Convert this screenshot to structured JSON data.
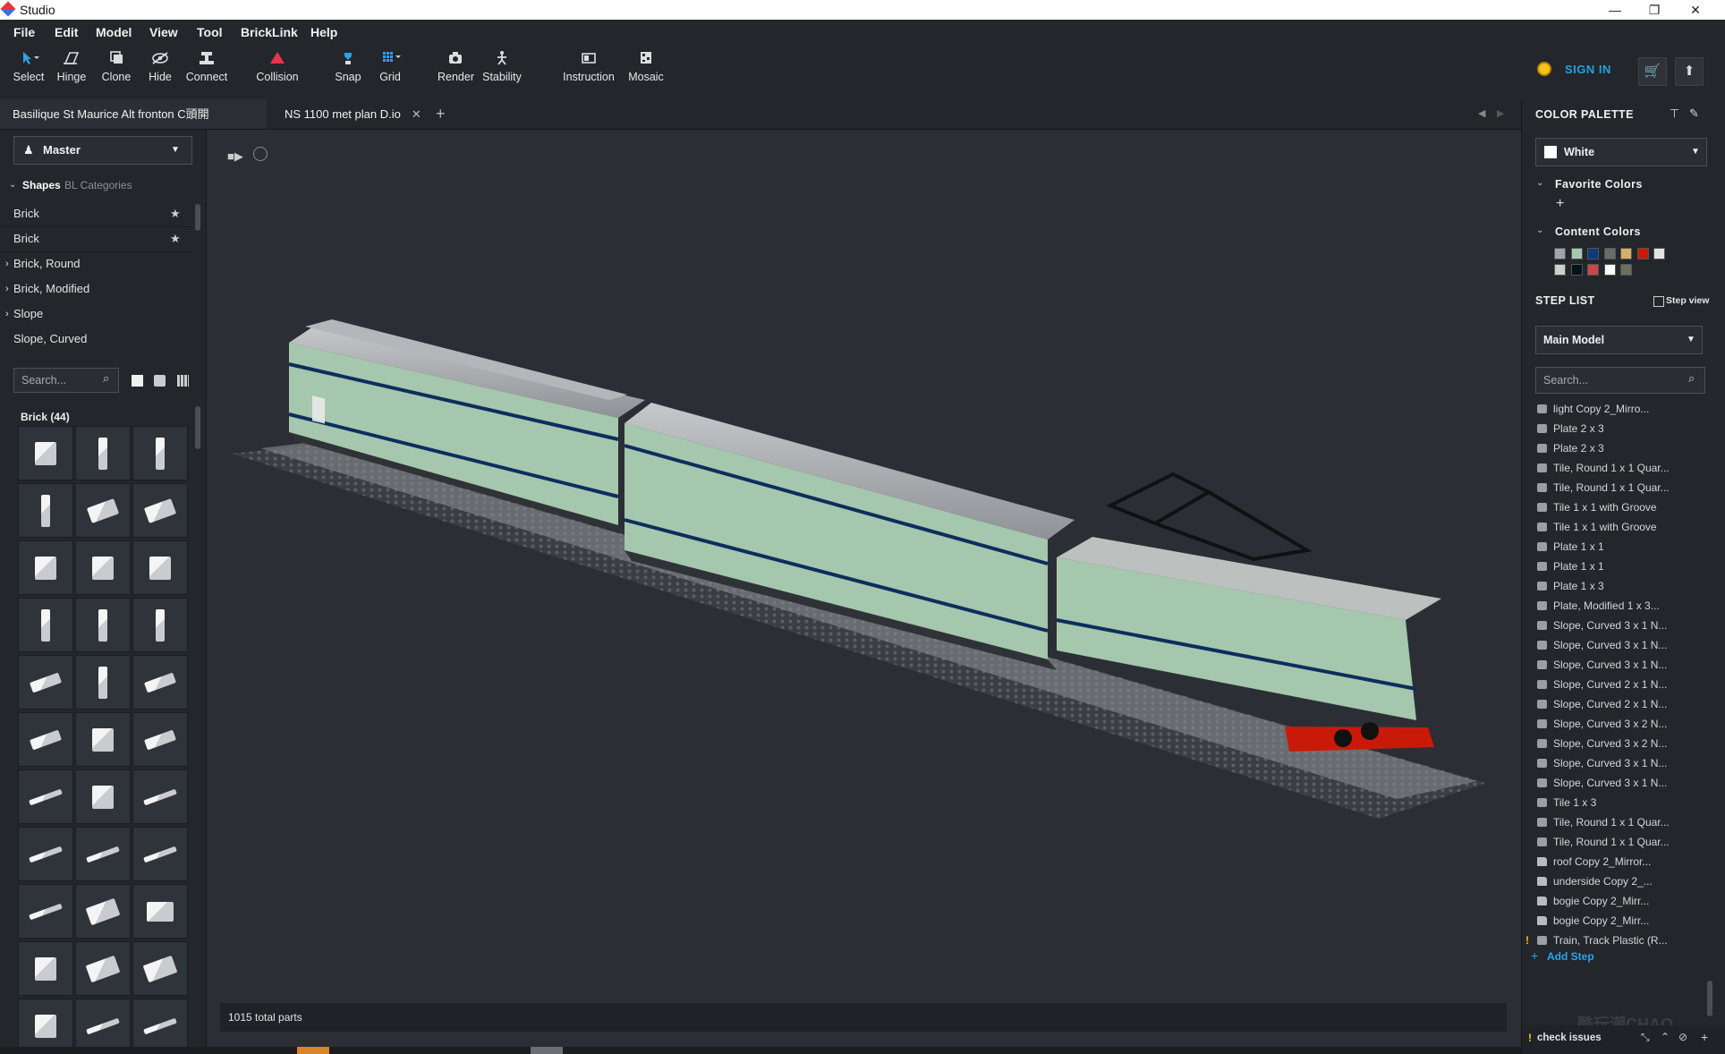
{
  "window": {
    "title": "Studio",
    "controls": [
      "—",
      "❐",
      "✕"
    ]
  },
  "menu": [
    "File",
    "Edit",
    "Model",
    "View",
    "Tool",
    "BrickLink",
    "Help"
  ],
  "toolbar": {
    "tools": [
      {
        "id": "select",
        "label": "Select"
      },
      {
        "id": "hinge",
        "label": "Hinge"
      },
      {
        "id": "clone",
        "label": "Clone"
      },
      {
        "id": "hide",
        "label": "Hide"
      },
      {
        "id": "connect",
        "label": "Connect"
      },
      {
        "id": "collision",
        "label": "Collision"
      },
      {
        "id": "snap",
        "label": "Snap"
      },
      {
        "id": "grid",
        "label": "Grid"
      },
      {
        "id": "render",
        "label": "Render"
      },
      {
        "id": "stability",
        "label": "Stability"
      },
      {
        "id": "instruction",
        "label": "Instruction"
      },
      {
        "id": "mosaic",
        "label": "Mosaic"
      }
    ],
    "sign_in": "SIGN IN"
  },
  "tabs": [
    {
      "label": "Basilique St Maurice Alt fronton C頭開Copy.io",
      "active": true
    },
    {
      "label": "NS 1100 met plan D.io",
      "active": false
    }
  ],
  "left": {
    "palette_select": "Master",
    "shape_tabs": {
      "shapes": "Shapes",
      "bl": "BL Categories"
    },
    "categories": [
      {
        "label": "Brick",
        "star": true
      },
      {
        "label": "Brick",
        "star": true
      },
      {
        "label": "Brick, Round",
        "expand": true
      },
      {
        "label": "Brick, Modified",
        "expand": true
      },
      {
        "label": "Slope",
        "expand": true
      },
      {
        "label": "Slope, Curved",
        "expand": false
      }
    ],
    "search_placeholder": "Search...",
    "brick_header": "Brick (44)"
  },
  "viewport": {
    "status": "1015 total parts"
  },
  "right": {
    "color_palette_title": "COLOR PALETTE",
    "selected_color": "White",
    "favorite_colors_title": "Favorite Colors",
    "content_colors_title": "Content Colors",
    "content_colors": [
      "#a0a5a9",
      "#a5c9b0",
      "#0d3a7a",
      "#6b6b6b",
      "#d4b068",
      "#c91a09",
      "#e4e4e4",
      "#cfd0cc",
      "#05131d",
      "#c9474a",
      "#ffffff",
      "#6d6e5c"
    ],
    "step_list_title": "STEP LIST",
    "step_view": "Step view",
    "model_select": "Main Model",
    "search_placeholder": "Search...",
    "steps": [
      {
        "label": "light Copy 2_Mirro...",
        "icon": "brick"
      },
      {
        "label": "Plate 2 x 3",
        "icon": "brick"
      },
      {
        "label": "Plate 2 x 3",
        "icon": "brick"
      },
      {
        "label": "Tile, Round 1 x 1 Quar...",
        "icon": "brick"
      },
      {
        "label": "Tile, Round 1 x 1 Quar...",
        "icon": "brick"
      },
      {
        "label": "Tile 1 x 1 with Groove",
        "icon": "brick"
      },
      {
        "label": "Tile 1 x 1 with Groove",
        "icon": "brick"
      },
      {
        "label": "Plate 1 x 1",
        "icon": "brick"
      },
      {
        "label": "Plate 1 x 1",
        "icon": "brick"
      },
      {
        "label": "Plate 1 x 3",
        "icon": "brick"
      },
      {
        "label": "Plate, Modified 1 x 3...",
        "icon": "brick"
      },
      {
        "label": "Slope, Curved 3 x 1 N...",
        "icon": "brick"
      },
      {
        "label": "Slope, Curved 3 x 1 N...",
        "icon": "brick"
      },
      {
        "label": "Slope, Curved 3 x 1 N...",
        "icon": "brick"
      },
      {
        "label": "Slope, Curved 2 x 1 N...",
        "icon": "brick"
      },
      {
        "label": "Slope, Curved 2 x 1 N...",
        "icon": "brick"
      },
      {
        "label": "Slope, Curved 3 x 2 N...",
        "icon": "brick"
      },
      {
        "label": "Slope, Curved 3 x 2 N...",
        "icon": "brick"
      },
      {
        "label": "Slope, Curved 3 x 1 N...",
        "icon": "brick"
      },
      {
        "label": "Slope, Curved 3 x 1 N...",
        "icon": "brick"
      },
      {
        "label": "Tile 1 x 3",
        "icon": "brick"
      },
      {
        "label": "Tile, Round 1 x 1 Quar...",
        "icon": "brick"
      },
      {
        "label": "Tile, Round 1 x 1 Quar...",
        "icon": "brick"
      },
      {
        "label": "roof Copy 2_Mirror...",
        "icon": "folder"
      },
      {
        "label": "underside Copy 2_...",
        "icon": "folder"
      },
      {
        "label": "bogie Copy 2_Mirr...",
        "icon": "folder"
      },
      {
        "label": "bogie Copy 2_Mirr...",
        "icon": "folder"
      },
      {
        "label": "Train, Track Plastic (R...",
        "icon": "brick",
        "warn": true
      }
    ],
    "add_step": "Add Step",
    "check_issues": "check issues",
    "watermark": "酷玩潮CHAO"
  }
}
